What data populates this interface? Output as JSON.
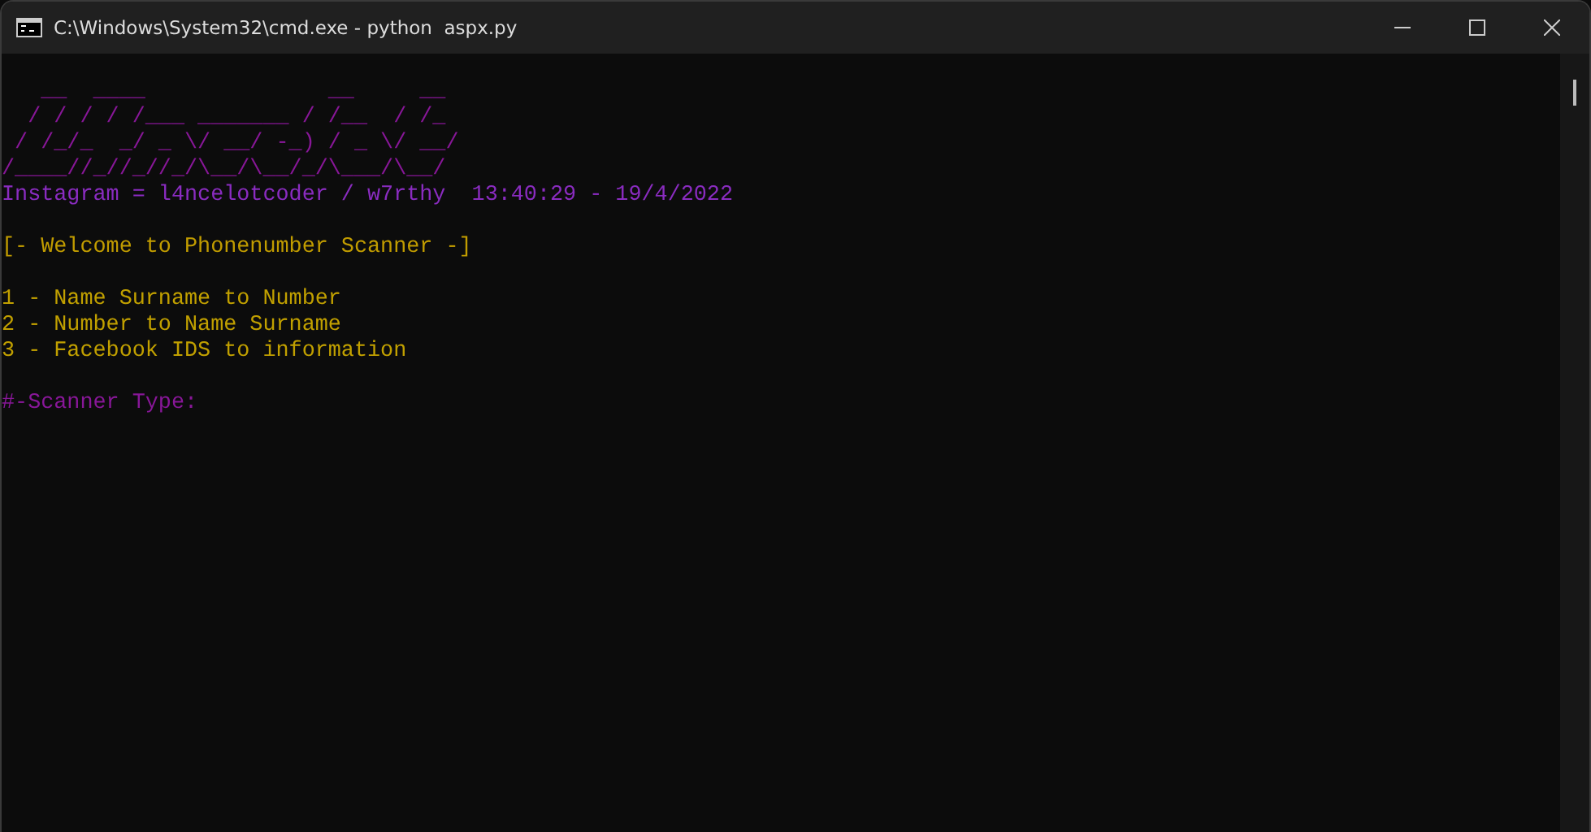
{
  "window": {
    "title": "C:\\Windows\\System32\\cmd.exe - python  aspx.py"
  },
  "terminal": {
    "lines": [
      {
        "kind": "art",
        "text": "   __  ____              __     __"
      },
      {
        "kind": "art",
        "text": "  / / / / /___ _______ / /__  / /_"
      },
      {
        "kind": "art",
        "text": " / /_/_  _/ _ \\/ __/ -_) / _ \\/ __/"
      },
      {
        "kind": "art",
        "text": "/____//_//_//_/\\__/\\__/_/\\___/\\__/"
      },
      {
        "kind": "info",
        "text": "Instagram = l4ncelotcoder / w7rthy  13:40:29 - 19/4/2022"
      },
      {
        "kind": "heading",
        "text": "[- Welcome to Phonenumber Scanner -]"
      },
      {
        "kind": "option",
        "text": "1 - Name Surname to Number"
      },
      {
        "kind": "option",
        "text": "2 - Number to Name Surname"
      },
      {
        "kind": "option",
        "text": "3 - Facebook IDS to information"
      },
      {
        "kind": "prompt",
        "text": "#-Scanner Type:"
      }
    ]
  }
}
